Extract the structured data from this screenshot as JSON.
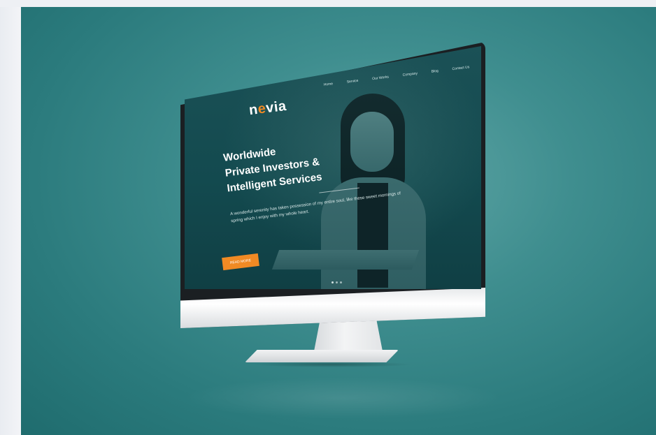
{
  "mockup": {
    "logo": {
      "prefix": "n",
      "accent": "e",
      "suffix": "via"
    },
    "nav": [
      "Home",
      "Service",
      "Our Works",
      "Company",
      "Blog",
      "Contact Us"
    ],
    "hero": {
      "lines": [
        "Worldwide",
        "Private Investors &",
        "Intelligent Services"
      ],
      "description": "A wonderful serenity has taken possession of my entire soul, like these sweet mornings of spring which I enjoy with my whole heart.",
      "cta_label": "READ MORE"
    },
    "slider": {
      "dots": 3,
      "active": 0
    },
    "colors": {
      "accent": "#f08a24",
      "background": "#2b7b7d",
      "screen": "#134a4f"
    }
  }
}
